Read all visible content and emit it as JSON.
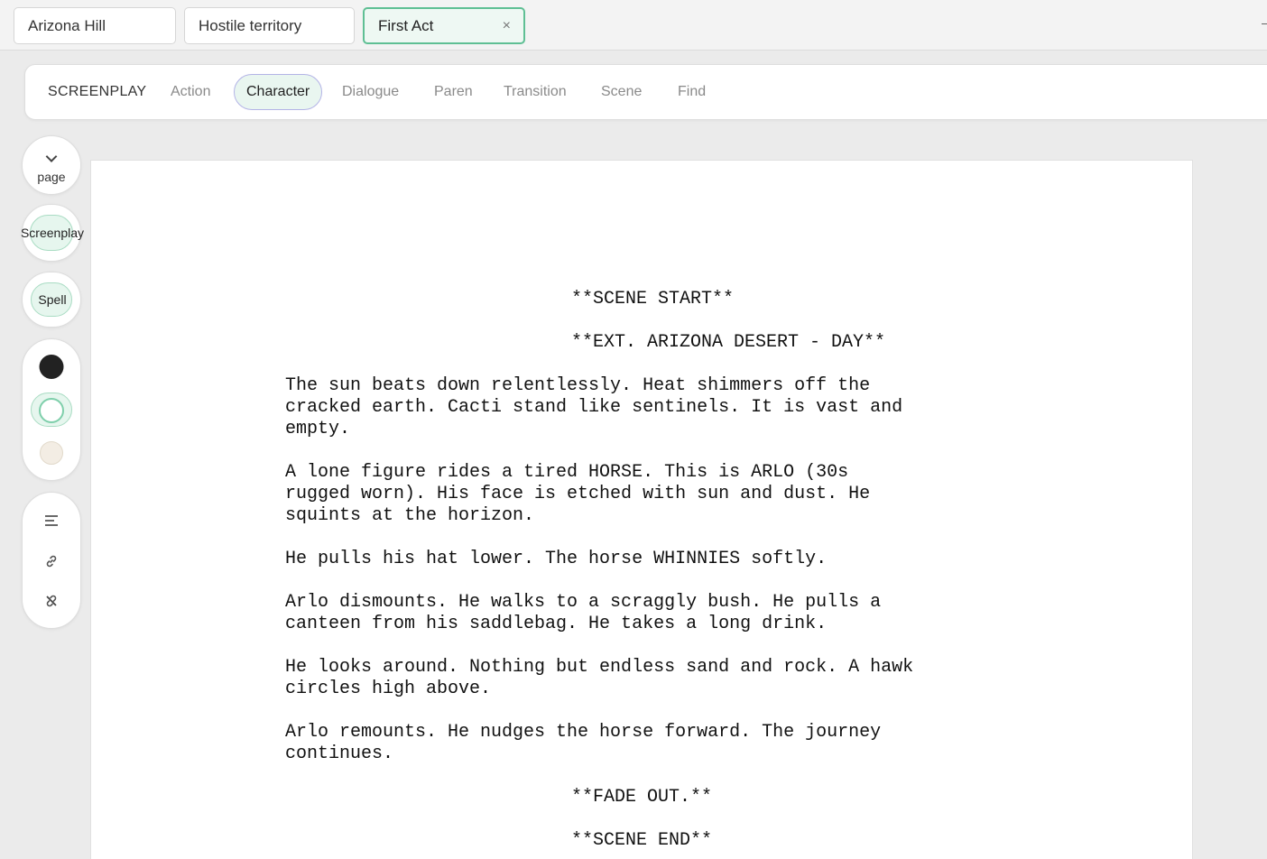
{
  "tabs": [
    {
      "label": "Arizona Hill"
    },
    {
      "label": "Hostile territory"
    },
    {
      "label": "First Act",
      "close": "×"
    }
  ],
  "toolbar": {
    "brand": "SCREENPLAY",
    "items": [
      "Action",
      "Character",
      "Dialogue",
      "Paren",
      "Transition",
      "Scene",
      "Find"
    ],
    "active": "Character"
  },
  "rail": {
    "page_label": "page",
    "screenplay_label": "Screenplay",
    "spell_label": "Spell",
    "colors": [
      "#222222",
      "#ffffff",
      "#f3ede4"
    ],
    "selected_color": "#ffffff",
    "icons": [
      "align-icon",
      "link-icon",
      "unlink-icon"
    ]
  },
  "script": {
    "scene_start": "**SCENE START**",
    "heading": "**EXT. ARIZONA DESERT - DAY**",
    "paragraphs": [
      "The sun beats down relentlessly. Heat shimmers off the\ncracked earth. Cacti stand like sentinels. It is vast and\nempty.",
      "A lone figure rides a tired HORSE. This is ARLO (30s\nrugged worn). His face is etched with sun and dust. He\nsquints at the horizon.",
      "He pulls his hat lower. The horse WHINNIES softly.",
      "Arlo dismounts. He walks to a scraggly bush. He pulls a\ncanteen from his saddlebag. He takes a long drink.",
      "He looks around. Nothing but endless sand and rock. A hawk\ncircles high above.",
      "Arlo remounts. He nudges the horse forward. The journey\ncontinues."
    ],
    "fade_out": "**FADE OUT.**",
    "scene_end": "**SCENE END**"
  }
}
